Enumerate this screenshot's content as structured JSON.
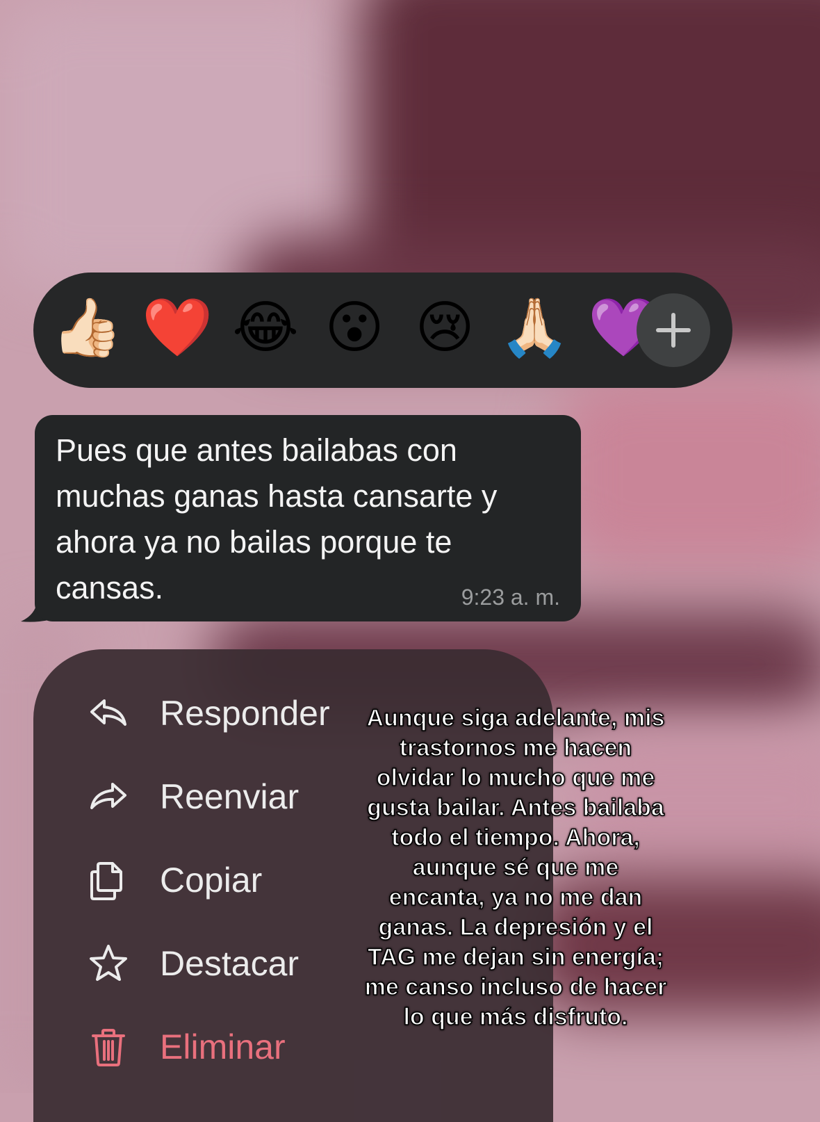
{
  "reactions": {
    "emojis": [
      "👍🏻",
      "❤️",
      "😂",
      "😮",
      "😢",
      "🙏🏻",
      "💜"
    ],
    "emoji_names": [
      "thumbs-up",
      "red-heart",
      "tears-of-joy",
      "surprised",
      "crying",
      "praying-hands",
      "purple-heart"
    ],
    "add_icon": "plus-icon"
  },
  "message": {
    "text": "Pues que antes bailabas con muchas ganas hasta cansarte y ahora ya no bailas porque te cansas.",
    "time": "9:23 a. m."
  },
  "menu": {
    "items": [
      {
        "label": "Responder",
        "icon": "reply-icon"
      },
      {
        "label": "Reenviar",
        "icon": "forward-icon"
      },
      {
        "label": "Copiar",
        "icon": "copy-icon"
      },
      {
        "label": "Destacar",
        "icon": "star-icon"
      },
      {
        "label": "Eliminar",
        "icon": "trash-icon",
        "color": "#e9707d"
      }
    ]
  },
  "caption": "Aunque siga adelante, mis trastornos me hacen olvidar lo mucho que me gusta bailar. Antes bailaba todo el tiempo. Ahora, aunque sé que me encanta, ya no me dan ganas. La depresión y el TAG me dejan sin energía; me canso incluso de hacer lo que más disfruto."
}
